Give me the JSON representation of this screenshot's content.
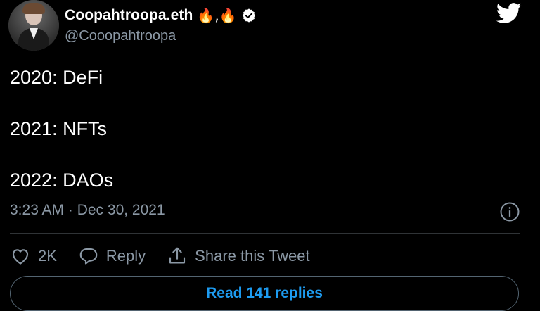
{
  "author": {
    "display_name": "Coopahtroopa.eth",
    "emoji_badges": "🔥,🔥",
    "handle": "@Cooopahtroopa",
    "verified": true
  },
  "tweet": {
    "lines": [
      "2020: DeFi",
      "2021: NFTs",
      "2022: DAOs"
    ],
    "timestamp": "3:23 AM · Dec 30, 2021"
  },
  "actions": {
    "like_count": "2K",
    "reply_label": "Reply",
    "share_label": "Share this Tweet"
  },
  "read_replies_label": "Read 141 replies",
  "icons": {
    "brand": "twitter-bird-icon",
    "info": "info-icon",
    "like": "heart-icon",
    "reply": "speech-bubble-icon",
    "share": "share-icon",
    "verified": "verified-badge-icon"
  },
  "colors": {
    "background": "#000000",
    "text": "#ffffff",
    "secondary": "#8b98a5",
    "accent": "#1d9bf0",
    "divider": "#2f3336"
  }
}
